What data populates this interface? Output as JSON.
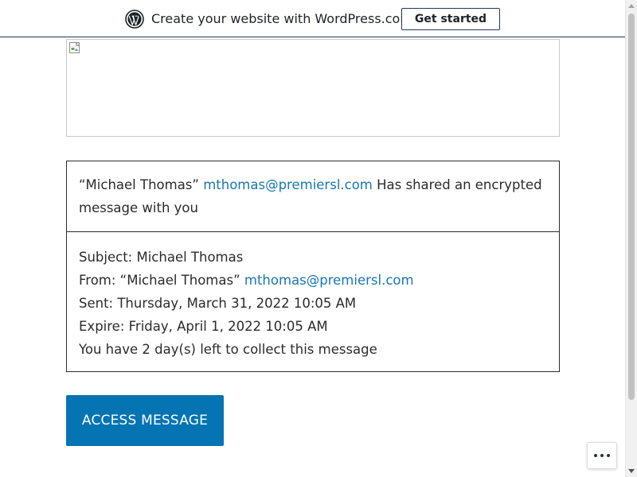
{
  "wp_bar": {
    "text": "Create your website with WordPress.com",
    "button_label": "Get started",
    "logo_icon": "wordpress-logo-icon"
  },
  "banner": {
    "icon": "broken-image-icon"
  },
  "message": {
    "sender_name": "“Michael Thomas”",
    "sender_email": "mthomas@premiersl.com",
    "shared_text": "Has shared an encrypted message with you",
    "subject": "Subject: Michael Thomas",
    "from_label": "From: “Michael Thomas”",
    "from_email": "mthomas@premiersl.com",
    "sent": "Sent: Thursday, March 31, 2022 10:05 AM",
    "expire": "Expire: Friday, April 1, 2022 10:05 AM",
    "remaining": "You have 2 day(s) left to collect this message"
  },
  "access_button": {
    "label": "ACCESS MESSAGE"
  },
  "more_button": {
    "icon": "ellipsis-icon"
  },
  "colors": {
    "link": "#1777b5",
    "primary_button": "#0474b3",
    "wp_border": "#1e3a57"
  }
}
